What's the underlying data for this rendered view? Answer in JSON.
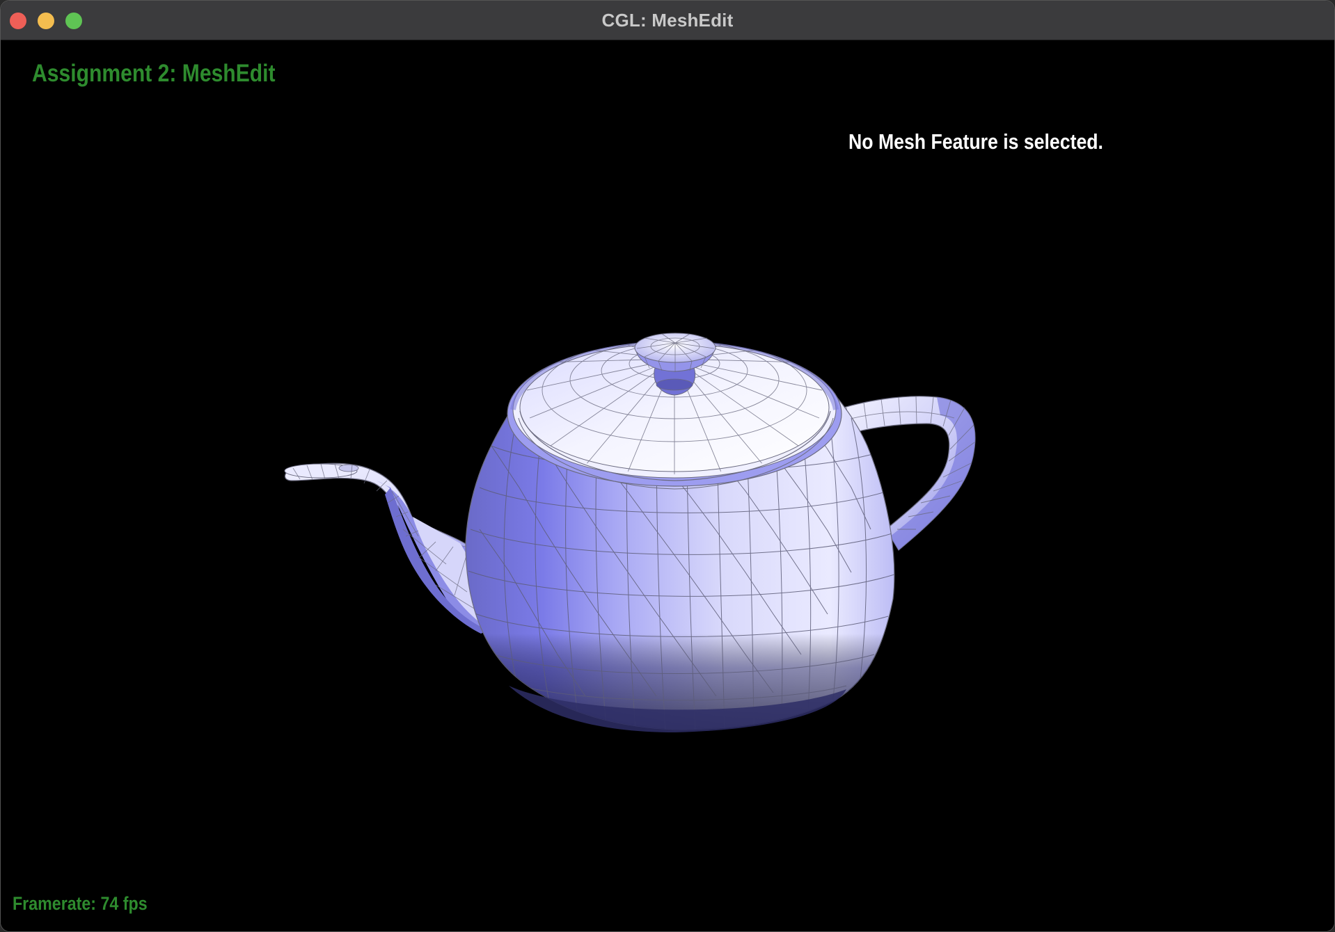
{
  "window": {
    "title": "CGL: MeshEdit",
    "controls": {
      "close": "#ee5f57",
      "minimize": "#f4bd4f",
      "maximize": "#5fc454"
    }
  },
  "overlay": {
    "assignment_title": "Assignment 2: MeshEdit",
    "selection_status": "No Mesh Feature is selected.",
    "framerate_label": "Framerate:",
    "framerate_value": "74",
    "framerate_unit": "fps"
  },
  "model": {
    "name": "teapot",
    "render_mode": "shaded-wireframe"
  },
  "colors": {
    "background": "#000000",
    "overlay_green": "#2e8b2e",
    "mesh_light": "#f2f2ff",
    "mesh_mid": "#b3b3f5",
    "mesh_dark": "#7070cc",
    "mesh_shadow": "#3a3a70",
    "wire": "#6b6b80"
  }
}
